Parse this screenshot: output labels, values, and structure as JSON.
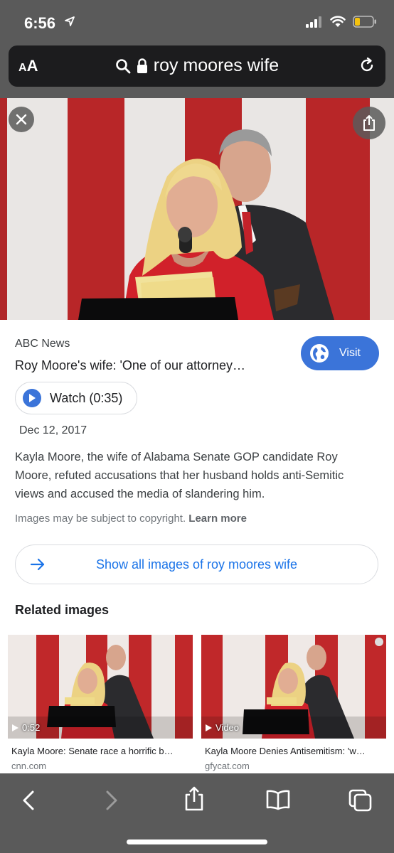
{
  "status": {
    "time": "6:56"
  },
  "urlbar": {
    "aa_big": "A",
    "aa_label": "A",
    "query": "roy moores wife"
  },
  "result": {
    "source": "ABC News",
    "title": "Roy Moore's wife: 'One of our attorney…",
    "visit_label": "Visit",
    "watch_label": "Watch (0:35)",
    "date": "Dec 12, 2017",
    "description": "Kayla Moore, the wife of Alabama Senate GOP candidate Roy Moore, refuted accusations that her husband holds anti-Semitic views and accused the media of slandering him.",
    "copyright_text": "Images may be subject to copyright.",
    "learn_more": "Learn more",
    "show_all_label": "Show all images of roy moores wife"
  },
  "related": {
    "heading": "Related images",
    "items": [
      {
        "badge": "0:52",
        "title": "Kayla Moore: Senate race a horrific b…",
        "domain": "cnn.com"
      },
      {
        "badge": "Video",
        "title": "Kayla Moore Denies Antisemitism: 'w…",
        "domain": "gfycat.com"
      }
    ]
  },
  "colors": {
    "accent": "#3b74d9",
    "link": "#1a73e8",
    "chrome": "#5a5a5a",
    "flag_red": "#c0282a"
  }
}
